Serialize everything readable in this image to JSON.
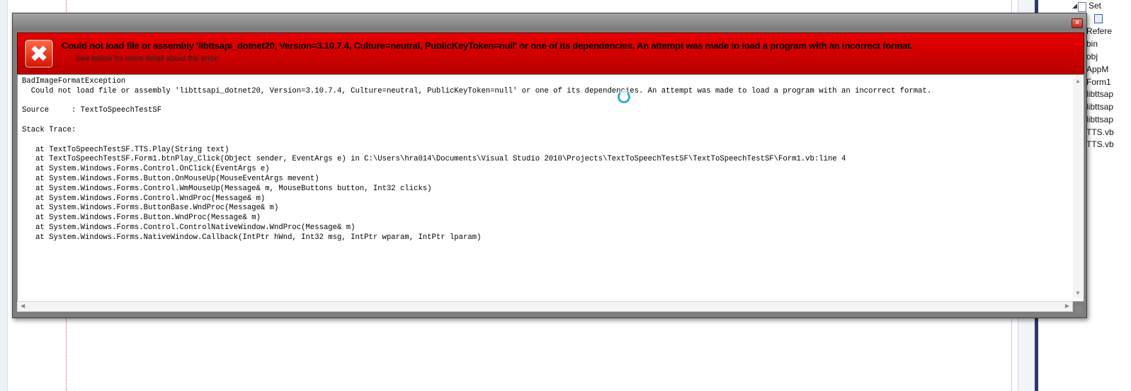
{
  "error_window": {
    "title": "Could not load file or assembly 'libttsapi_dotnet20, Version=3.10.7.4, Culture=neutral, PublicKeyToken=null' or one of its dependencies. An attempt was made to load a program with an incorrect format.",
    "subtitle": "See below for more detail about the error.",
    "close_glyph": "×",
    "error_icon_glyph": "✖",
    "detail_text": "BadImageFormatException\n  Could not load file or assembly 'libttsapi_dotnet20, Version=3.10.7.4, Culture=neutral, PublicKeyToken=null' or one of its dependencies. An attempt was made to load a program with an incorrect format.\n\nSource     : TextToSpeechTestSF\n\nStack Trace:\n\n   at TextToSpeechTestSF.TTS.Play(String text)\n   at TextToSpeechTestSF.Form1.btnPlay_Click(Object sender, EventArgs e) in C:\\Users\\hra014\\Documents\\Visual Studio 2010\\Projects\\TextToSpeechTestSF\\TextToSpeechTestSF\\Form1.vb:line 4\n   at System.Windows.Forms.Control.OnClick(EventArgs e)\n   at System.Windows.Forms.Button.OnMouseUp(MouseEventArgs mevent)\n   at System.Windows.Forms.Control.WmMouseUp(Message& m, MouseButtons button, Int32 clicks)\n   at System.Windows.Forms.Control.WndProc(Message& m)\n   at System.Windows.Forms.ButtonBase.WndProc(Message& m)\n   at System.Windows.Forms.Button.WndProc(Message& m)\n   at System.Windows.Forms.Control.ControlNativeWindow.WndProc(Message& m)\n   at System.Windows.Forms.NativeWindow.Callback(IntPtr hWnd, Int32 msg, IntPtr wparam, IntPtr lparam)",
    "scroll_up_glyph": "▲",
    "scroll_down_glyph": "▼",
    "scroll_left_glyph": "◀",
    "scroll_right_glyph": "▶"
  },
  "solution_explorer": {
    "items": [
      "Set",
      "Refere",
      "bin",
      "obj",
      "AppM",
      "Form1",
      "libttsap",
      "libttsap",
      "libttsap",
      "TTS.vb",
      "TTS.vb"
    ],
    "expand_glyph": "◢"
  },
  "colors": {
    "error_header": "#d40000",
    "window_frame": "#7e7e7e",
    "accent_navy": "#2b3a67"
  },
  "icons": [
    "error-icon",
    "close-icon",
    "busy-cursor-icon",
    "file-icon"
  ]
}
